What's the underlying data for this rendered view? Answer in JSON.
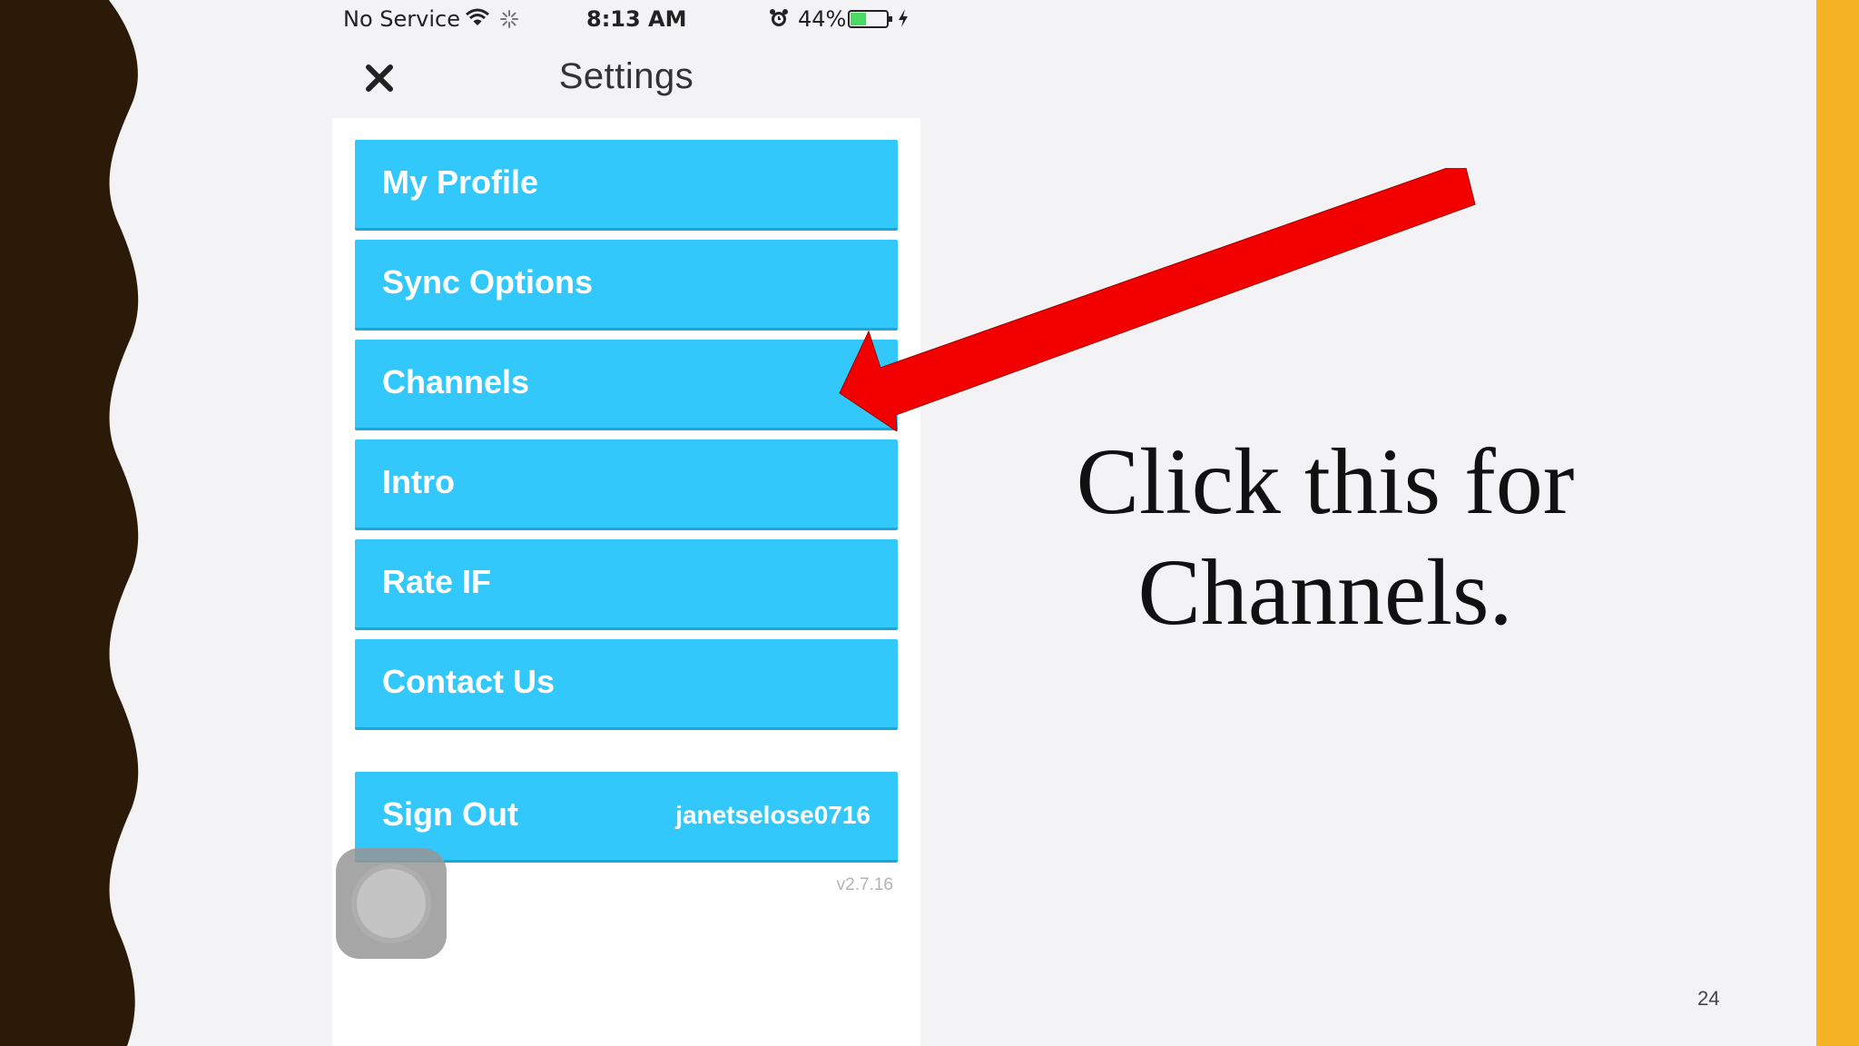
{
  "status_bar": {
    "carrier": "No Service",
    "time": "8:13 AM",
    "battery_percent": "44%",
    "battery_level": 0.44,
    "icons": [
      "wifi-icon",
      "spinner-icon",
      "alarm-icon",
      "battery-icon",
      "bolt-icon"
    ]
  },
  "nav": {
    "close_icon": "close-icon",
    "title": "Settings"
  },
  "menu": {
    "items": [
      {
        "label": "My Profile"
      },
      {
        "label": "Sync Options"
      },
      {
        "label": "Channels"
      },
      {
        "label": "Intro"
      },
      {
        "label": "Rate IF"
      },
      {
        "label": "Contact Us"
      }
    ],
    "sign_out": {
      "label": "Sign Out",
      "username": "janetselose0716"
    },
    "version": "v2.7.16"
  },
  "annotation": {
    "text": "Click this for Channels.",
    "arrow_color": "#f20000"
  },
  "slide": {
    "number": "24"
  },
  "colors": {
    "button": "#33c8fb",
    "accent_bar": "#f5b324",
    "wave": "#2c1a08"
  }
}
